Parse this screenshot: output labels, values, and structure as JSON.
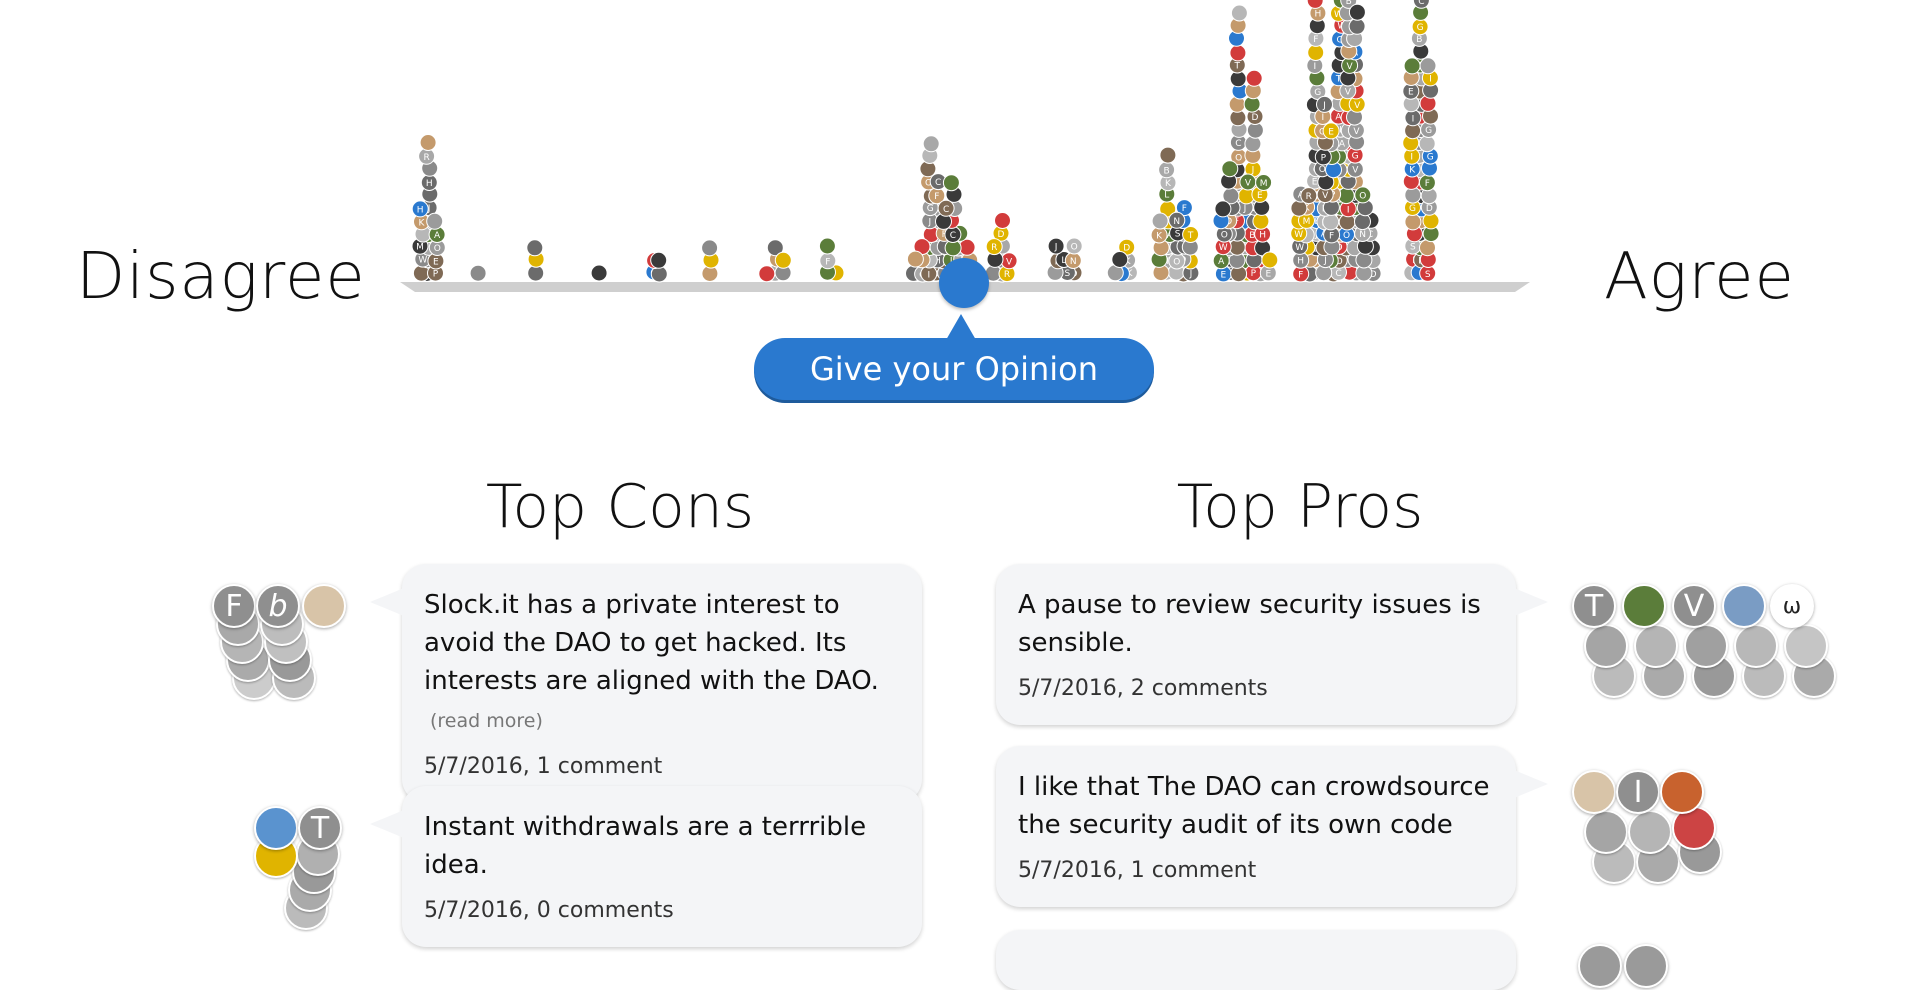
{
  "scale": {
    "disagree_label": "Disagree",
    "agree_label": "Agree"
  },
  "opinion_button": {
    "label": "Give your Opinion",
    "color": "#2a79cf"
  },
  "cons": {
    "title": "Top Cons",
    "items": [
      {
        "text": "Slock.it has a private interest to avoid the DAO to get hacked. Its interests are aligned with the DAO.",
        "more": "(read more)",
        "meta": "5/7/2016, 1 comment",
        "avatars": [
          "F",
          "b",
          "photo"
        ]
      },
      {
        "text": "Instant withdrawals are a terrrible idea.",
        "meta": "5/7/2016, 0 comments",
        "avatars": [
          "photo",
          "T"
        ]
      }
    ]
  },
  "pros": {
    "title": "Top Pros",
    "items": [
      {
        "text": "A pause to review security issues is sensible.",
        "meta": "5/7/2016, 2 comments",
        "avatars": [
          "T",
          "photo",
          "V",
          "photo",
          "ω"
        ]
      },
      {
        "text": "I like that The DAO can crowdsource the security audit of its own code",
        "meta": "5/7/2016, 1 comment",
        "avatars": [
          "photo",
          "I",
          "photo"
        ]
      }
    ]
  },
  "colors": {
    "accent": "#2a79cf",
    "card_bg": "#f4f5f7",
    "avatar_gray": "#8f8f8f",
    "baseline": "#cfcfcf"
  }
}
